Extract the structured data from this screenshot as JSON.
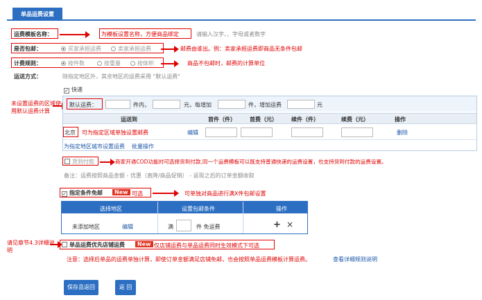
{
  "tab": {
    "label": "单品运费设置"
  },
  "template_name": {
    "label": "运费模板名称：",
    "annotation": "为模板设置名称，方便商品绑定",
    "hint": "请输入汉字、、字母或者数字"
  },
  "free_shipping": {
    "label": "是否包邮：",
    "options": [
      "买家承担运费",
      "卖家承担运费"
    ],
    "annotation": "邮费由谁出。例：卖家承担运费即商品无条件包邮"
  },
  "pricing_rule": {
    "label": "计费规则：",
    "options": [
      "按件数",
      "按重量",
      "按体积"
    ],
    "annotation": "商品不包邮时，邮费的计算单位"
  },
  "delivery": {
    "label": "运送方式：",
    "desc": "除指定地区外，其余地区的运费采用 \"默认运费\"",
    "express_label": "快递",
    "side_annotation": "未设置运费的区域使用默认运费计算",
    "default_fee": {
      "label": "默认运费：",
      "t1": "件内，",
      "t2": "元，每增加",
      "t3": "件，增加运费",
      "t4": "元"
    },
    "table_headers": [
      "运送到",
      "首件（件）",
      "首费（元）",
      "续件（件）",
      "续费（元）",
      "操作"
    ],
    "row": {
      "region": "北京",
      "region_annotation": "可为指定区域单独设置邮费",
      "edit": "编辑",
      "delete": "删除"
    },
    "links": {
      "set_region": "为指定地区城市设置运费",
      "batch": "批量操作"
    },
    "cod_label": "货到付款",
    "cod_annotation": "商家开通COD功能时可选择货到付款.同一个运费模板可以既支持普通快递的运费设置，也支持货到付款的运费设置。",
    "note": "备注：运费按照商品金额 - 优惠（直降/商品促销） - 返现之后的订单金额收取"
  },
  "free_condition": {
    "label": "指定条件免邮",
    "new_badge": "New",
    "optional": "可选",
    "annotation": "可单独对商品进行满X件包邮设置",
    "table_headers": [
      "选择地区",
      "设置包邮条件",
      "操作"
    ],
    "row": {
      "region": "未添加地区",
      "edit": "编辑",
      "cond_prefix": "满",
      "cond_suffix": "件 免运费",
      "add": "+",
      "remove": "×"
    }
  },
  "store_priority": {
    "side_annotation": "请见章节4.3详细说明",
    "label": "单品运费优先店铺运费",
    "new_badge": "New",
    "optional_note": "仅店铺运费与单品运费同时生效模式下可选",
    "notice": "注意：选择后单品的运费单独计算，即使订单金额满足店铺免邮，也会按照单品运费模板计算运费。",
    "rules_link": "查看详细规则说明"
  },
  "buttons": {
    "save_return": "保存且返回",
    "back": "返 回"
  }
}
